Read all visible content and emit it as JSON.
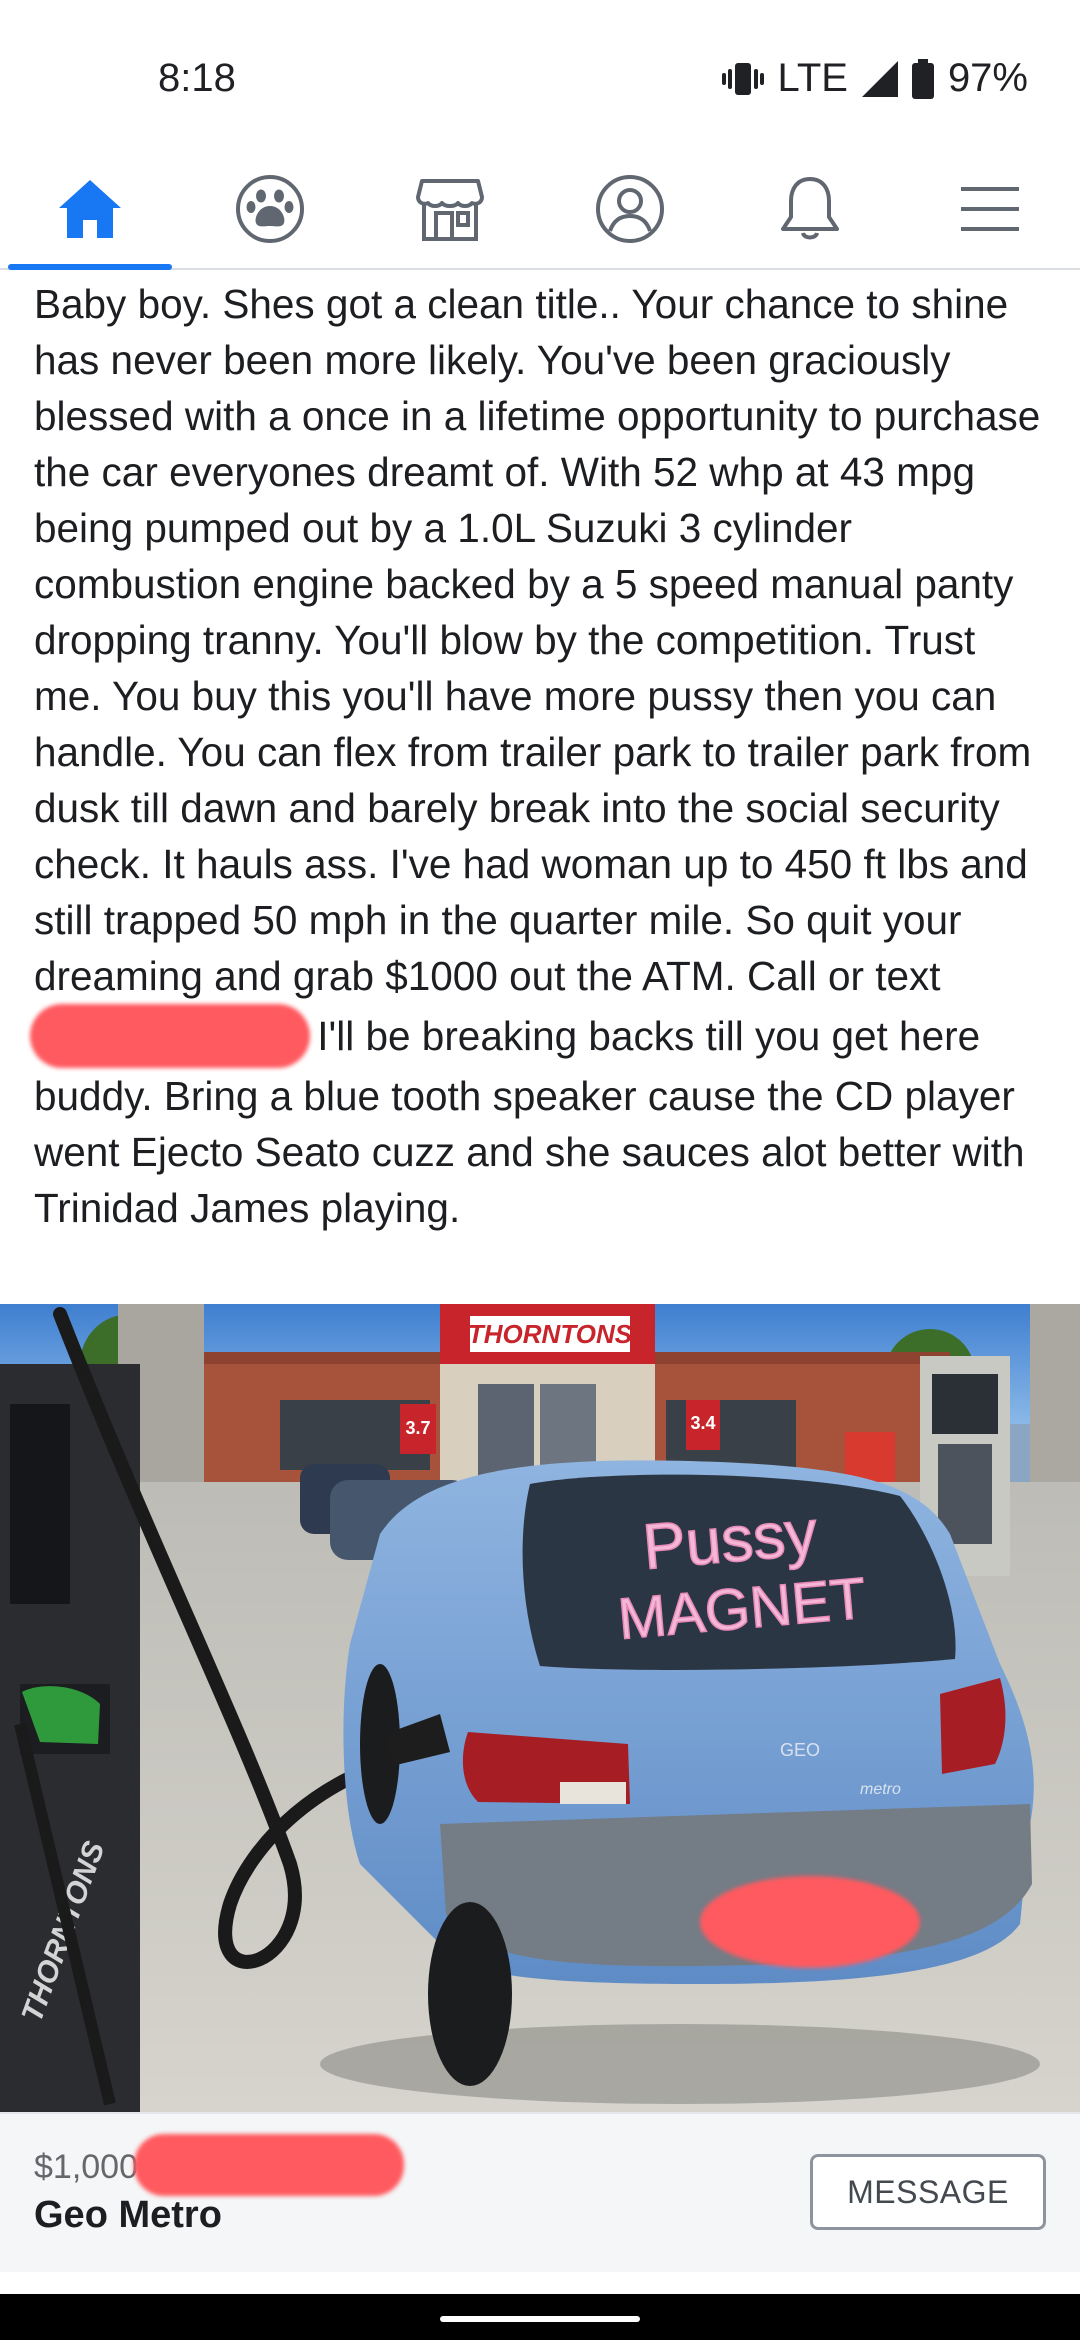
{
  "status_bar": {
    "time": "8:18",
    "network": "LTE",
    "battery": "97%",
    "icons": [
      "vibrate-icon",
      "signal-icon",
      "battery-icon"
    ]
  },
  "nav": {
    "tabs": [
      {
        "name": "home",
        "icon": "home-icon",
        "active": true
      },
      {
        "name": "groups",
        "icon": "groups-icon",
        "active": false
      },
      {
        "name": "marketplace",
        "icon": "marketplace-icon",
        "active": false
      },
      {
        "name": "profile",
        "icon": "profile-icon",
        "active": false
      },
      {
        "name": "notifications",
        "icon": "bell-icon",
        "active": false
      },
      {
        "name": "menu",
        "icon": "menu-icon",
        "active": false
      }
    ],
    "accent_color": "#1877f2"
  },
  "post": {
    "text_before_redaction": "Baby boy. Shes got a clean title.. Your chance to shine has never been more likely. You've been graciously blessed with a once in a lifetime opportunity to purchase the car everyones dreamt of. With 52 whp at 43 mpg being pumped out by a 1.0L Suzuki 3 cylinder combustion engine backed by a 5 speed manual panty dropping tranny. You'll blow by the competition. Trust me. You buy this you'll have more pussy then you can handle. You can flex from trailer park to trailer park from dusk till dawn and barely break into the social security check. It hauls ass. I've had woman up to 450 ft lbs and still trapped 50 mph in the quarter mile. So quit your dreaming and grab $1000 out the ATM. Call or text",
    "text_after_redaction": "I'll be breaking backs till you get here buddy. Bring a blue tooth speaker cause the CD player went Ejecto Seato cuzz and she sauces alot better with Trinidad James playing."
  },
  "photo": {
    "store_sign": "THORNTONS",
    "pump_brand": "THORNTONS",
    "window_text_line1": "Pussy",
    "window_text_line2": "MAGNET",
    "trunk_badge": "GEO",
    "trunk_model": "metro",
    "price_sign": "3.7",
    "promo_sign": "3.4"
  },
  "listing": {
    "price": "$1,000",
    "title": "Geo Metro",
    "message_button": "MESSAGE"
  }
}
